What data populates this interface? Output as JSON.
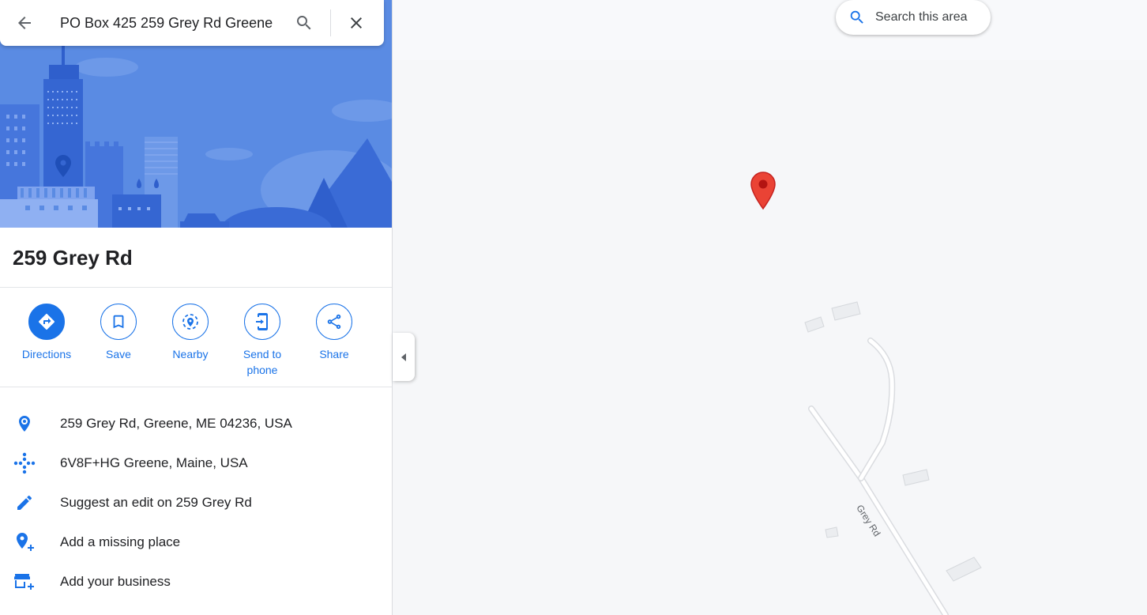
{
  "search": {
    "query": "PO Box 425 259 Grey Rd Greene"
  },
  "place": {
    "title": "259 Grey Rd"
  },
  "actions": [
    {
      "label": "Directions",
      "icon": "directions-icon"
    },
    {
      "label": "Save",
      "icon": "bookmark-icon"
    },
    {
      "label": "Nearby",
      "icon": "nearby-icon"
    },
    {
      "label": "Send to phone",
      "icon": "send-to-phone-icon"
    },
    {
      "label": "Share",
      "icon": "share-icon"
    }
  ],
  "info": [
    {
      "text": "259 Grey Rd, Greene, ME 04236, USA",
      "icon": "location-pin-icon"
    },
    {
      "text": "6V8F+HG Greene, Maine, USA",
      "icon": "plus-code-icon"
    },
    {
      "text": "Suggest an edit on 259 Grey Rd",
      "icon": "pencil-icon"
    },
    {
      "text": "Add a missing place",
      "icon": "add-place-icon"
    },
    {
      "text": "Add your business",
      "icon": "add-business-icon"
    }
  ],
  "map": {
    "search_area_label": "Search this area",
    "road_label": "Grey Rd"
  },
  "colors": {
    "accent": "#1a73e8",
    "pin": "#ea4335",
    "hero_bg": "#5a8be3"
  }
}
